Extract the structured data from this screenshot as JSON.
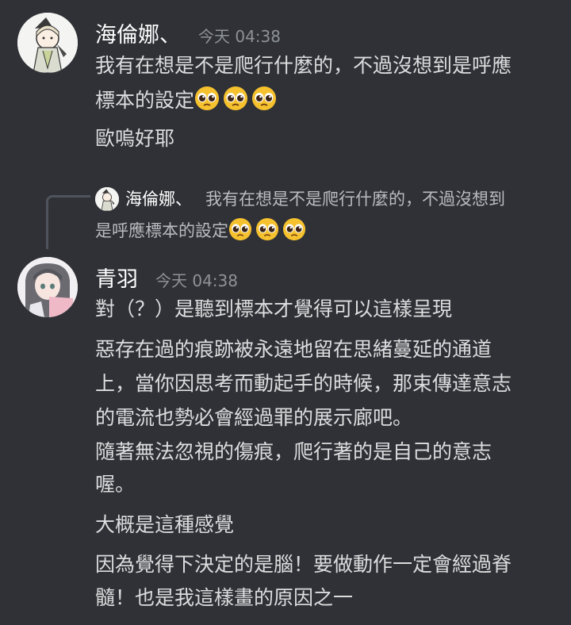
{
  "message1": {
    "username": "海倫娜、",
    "timestamp": "今天 04:38",
    "lines": [
      "我有在想是不是爬行什麼的，不過沒想到是呼應",
      "標本的設定",
      "歐嗚好耶"
    ],
    "emoji": "pleading-face-emoji"
  },
  "reply": {
    "username": "海倫娜、",
    "text_line1": "我有在想是不是爬行什麼的，不過沒想到",
    "text_line2": "是呼應標本的設定"
  },
  "message2": {
    "username": "青羽",
    "timestamp": "今天 04:38",
    "lines": [
      "對（？）是聽到標本才覺得可以這樣呈現",
      "惡存在過的痕跡被永遠地留在思緒蔓延的通道",
      "上，當你因思考而動起手的時候，那束傳達意志",
      "的電流也勢必會經過罪的展示廊吧。",
      "隨著無法忽視的傷痕，爬行著的是自己的意志",
      "喔。",
      "大概是這種感覺",
      "因為覺得下決定的是腦！要做動作一定會經過脊",
      "髓！也是我這樣畫的原因之一"
    ]
  },
  "colors": {
    "background": "#2f3136",
    "text": "#dcddde",
    "username": "#ffffff",
    "timestamp": "#8e9297",
    "reply_text": "#b9bbbe"
  }
}
